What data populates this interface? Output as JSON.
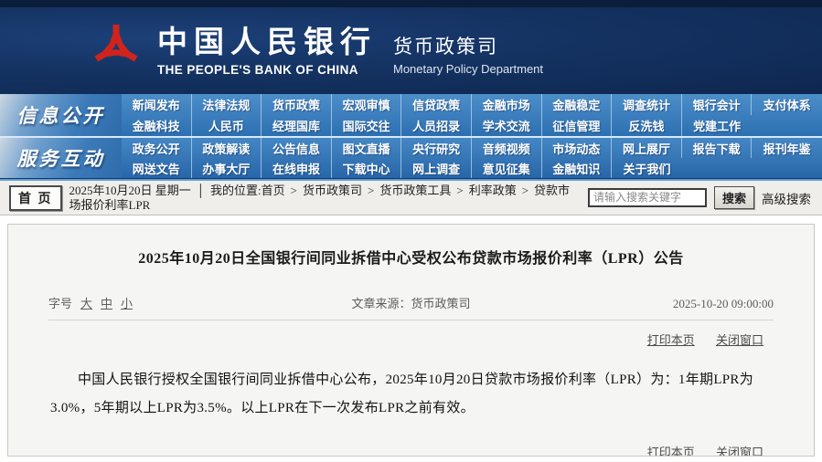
{
  "header": {
    "bank_name_cn": "中国人民银行",
    "bank_name_en": "THE PEOPLE'S BANK OF CHINA",
    "dept_cn": "货币政策司",
    "dept_en": "Monetary Policy Department"
  },
  "nav": {
    "sections": [
      {
        "label": "信息公开",
        "rows": [
          [
            "新闻发布",
            "法律法规",
            "货币政策",
            "宏观审慎",
            "信贷政策",
            "金融市场",
            "金融稳定",
            "调查统计",
            "银行会计",
            "支付体系"
          ],
          [
            "金融科技",
            "人民币",
            "经理国库",
            "国际交往",
            "人员招录",
            "学术交流",
            "征信管理",
            "反洗钱",
            "党建工作",
            ""
          ]
        ]
      },
      {
        "label": "服务互动",
        "rows": [
          [
            "政务公开",
            "政策解读",
            "公告信息",
            "图文直播",
            "央行研究",
            "音频视频",
            "市场动态",
            "网上展厅",
            "报告下载",
            "报刊年鉴"
          ],
          [
            "网送文告",
            "办事大厅",
            "在线申报",
            "下载中心",
            "网上调查",
            "意见征集",
            "金融知识",
            "关于我们",
            "",
            ""
          ]
        ]
      }
    ]
  },
  "breadcrumb_bar": {
    "home_button": "首 页",
    "date": "2025年10月20日 星期一",
    "divider": "│",
    "location_prefix": "我的位置:",
    "path": [
      "首页",
      "货币政策司",
      "货币政策工具",
      "利率政策",
      "贷款市场报价利率LPR"
    ],
    "path_separator": ">",
    "search_placeholder": "请输入搜索关键字",
    "search_button": "搜索",
    "advanced_search": "高级搜索"
  },
  "article": {
    "title": "2025年10月20日全国银行间同业拆借中心受权公布贷款市场报价利率（LPR）公告",
    "font_size_label": "字号",
    "font_sizes": [
      "大",
      "中",
      "小"
    ],
    "source_label": "文章来源：",
    "source": "货币政策司",
    "datetime": "2025-10-20 09:00:00",
    "links": {
      "print": "打印本页",
      "close": "关闭窗口"
    },
    "body": "中国人民银行授权全国银行间同业拆借中心公布，2025年10月20日贷款市场报价利率（LPR）为：1年期LPR为3.0%，5年期以上LPR为3.5%。以上LPR在下一次发布LPR之前有效。"
  },
  "colors": {
    "logo_red": "#cf241d",
    "header_navy": "#143261",
    "nav_blue": "#3579ba",
    "crumb_bg": "#efeeea",
    "article_bg": "#f5f5f3"
  }
}
